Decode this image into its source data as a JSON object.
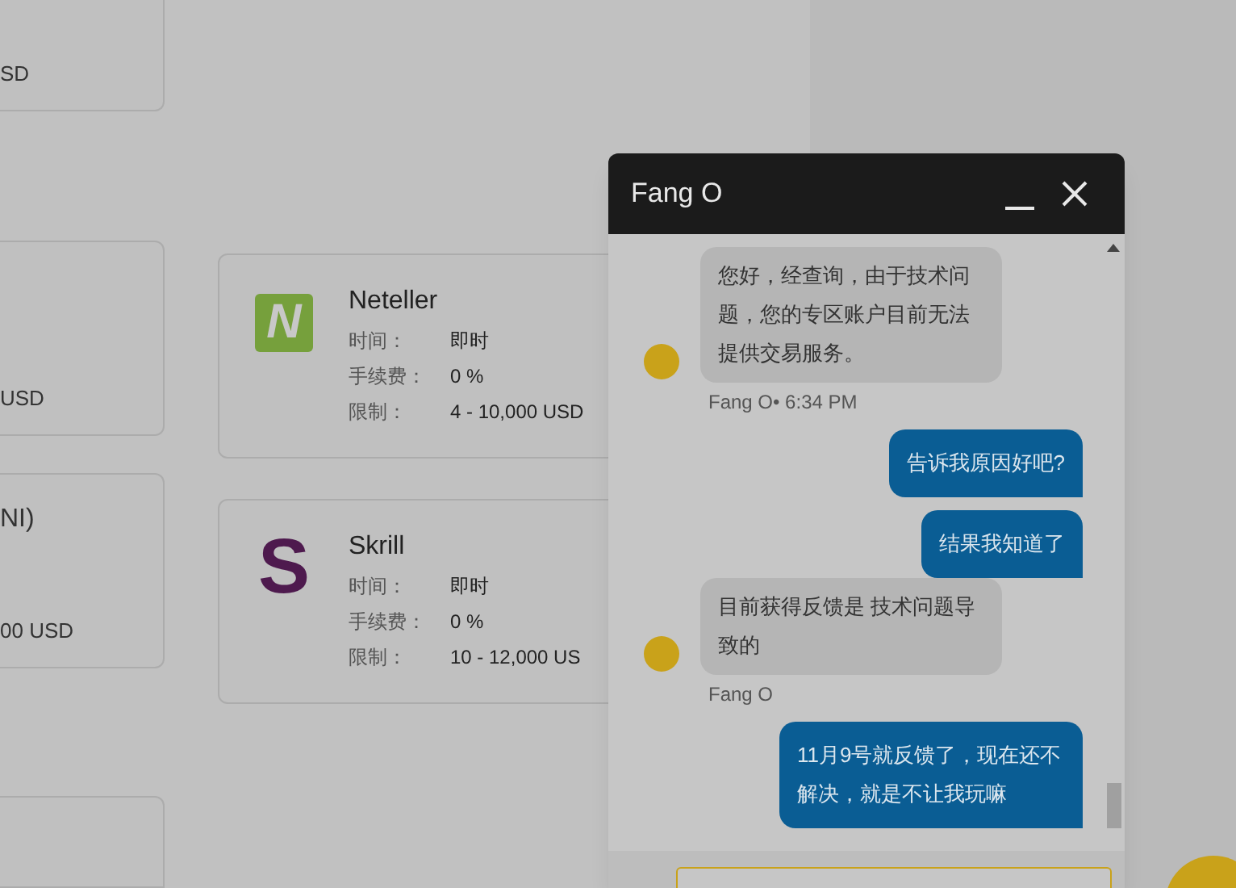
{
  "partial_cards": [
    {
      "texts": [
        "SD"
      ]
    },
    {
      "texts": [
        "USD"
      ]
    },
    {
      "texts": [
        "NI)",
        "00 USD"
      ]
    }
  ],
  "methods": [
    {
      "name": "Neteller",
      "kind": "tile",
      "logo_text": "N",
      "color": "#76a03c",
      "rows": [
        {
          "label": "时间：",
          "value": "即时"
        },
        {
          "label": "手续费：",
          "value": "0 %"
        },
        {
          "label": "限制：",
          "value": "4 - 10,000 USD"
        }
      ]
    },
    {
      "name": "Skrill",
      "kind": "letter",
      "logo_text": "S",
      "color": "#4e1a4e",
      "rows": [
        {
          "label": "时间：",
          "value": "即时"
        },
        {
          "label": "手续费：",
          "value": "0 %"
        },
        {
          "label": "限制：",
          "value": "10 - 12,000 US"
        }
      ]
    }
  ],
  "chat": {
    "title": "Fang O",
    "messages": [
      {
        "kind": "agent",
        "text": "您好，经查询，由于技术问题，您的专区账户目前无法提供交易服务。",
        "meta": "Fang O• 6:34 PM"
      },
      {
        "kind": "user",
        "text": "告诉我原因好吧?"
      },
      {
        "kind": "user",
        "text": "结果我知道了"
      },
      {
        "kind": "agent",
        "text": "目前获得反馈是  技术问题导致的",
        "meta": "Fang O"
      },
      {
        "kind": "user",
        "text": "11月9号就反馈了，现在还不解决，就是不让我玩嘛"
      }
    ]
  }
}
